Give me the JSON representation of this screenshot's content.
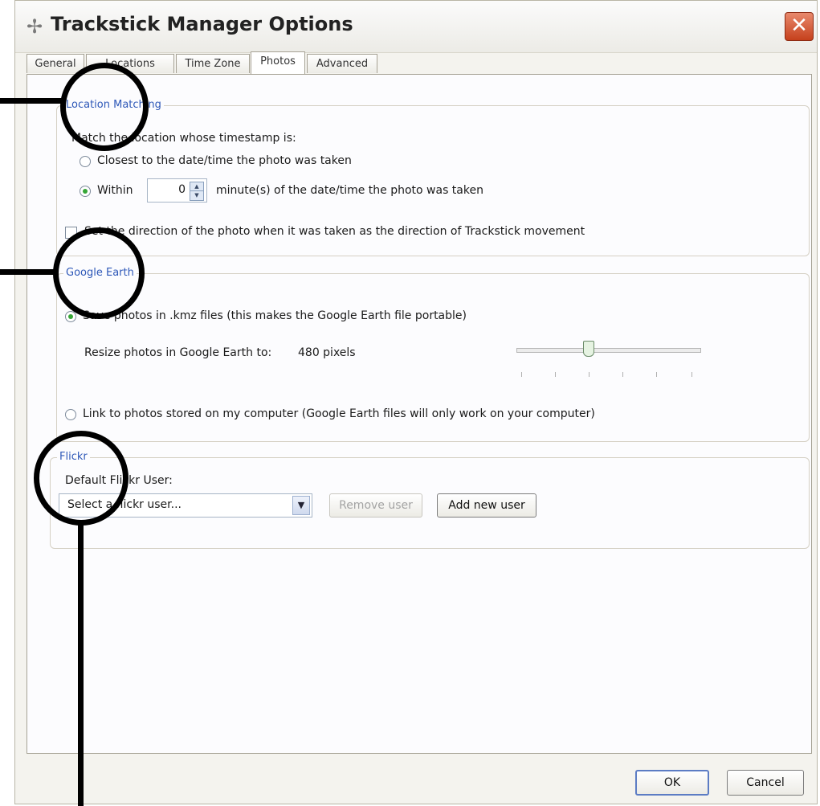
{
  "window": {
    "title": "Trackstick Manager Options"
  },
  "tabs": [
    {
      "label": "General"
    },
    {
      "label": "Locations"
    },
    {
      "label": "Time Zone"
    },
    {
      "label": "Photos"
    },
    {
      "label": "Advanced"
    }
  ],
  "active_tab": "Photos",
  "location_matching": {
    "legend": "Location Matching",
    "prompt": "Match the location whose timestamp is:",
    "closest_label": "Closest to the date/time the photo was taken",
    "within_label": "Within",
    "within_value": "0",
    "within_suffix": "minute(s) of the date/time the photo was taken",
    "direction_label": "Set the direction of the photo when it was taken as the direction of Trackstick movement"
  },
  "google_earth": {
    "legend": "Google Earth",
    "save_label": "Save photos in .kmz files (this makes the Google Earth file portable)",
    "resize_label": "Resize photos in Google Earth to:",
    "resize_value": "480 pixels",
    "link_label": "Link to photos stored on my computer (Google Earth files will only work on your computer)"
  },
  "flickr": {
    "legend": "Flickr",
    "default_user_label": "Default Flickr User:",
    "user_select_value": "Select a flickr user...",
    "remove_user_label": "Remove user",
    "add_user_label": "Add new user"
  },
  "footer": {
    "ok_label": "OK",
    "cancel_label": "Cancel"
  },
  "colors": {
    "legend": "#2e58b8",
    "radio_selected": "#36a637",
    "close_button": "#c5401c",
    "annotation": "#000000"
  }
}
